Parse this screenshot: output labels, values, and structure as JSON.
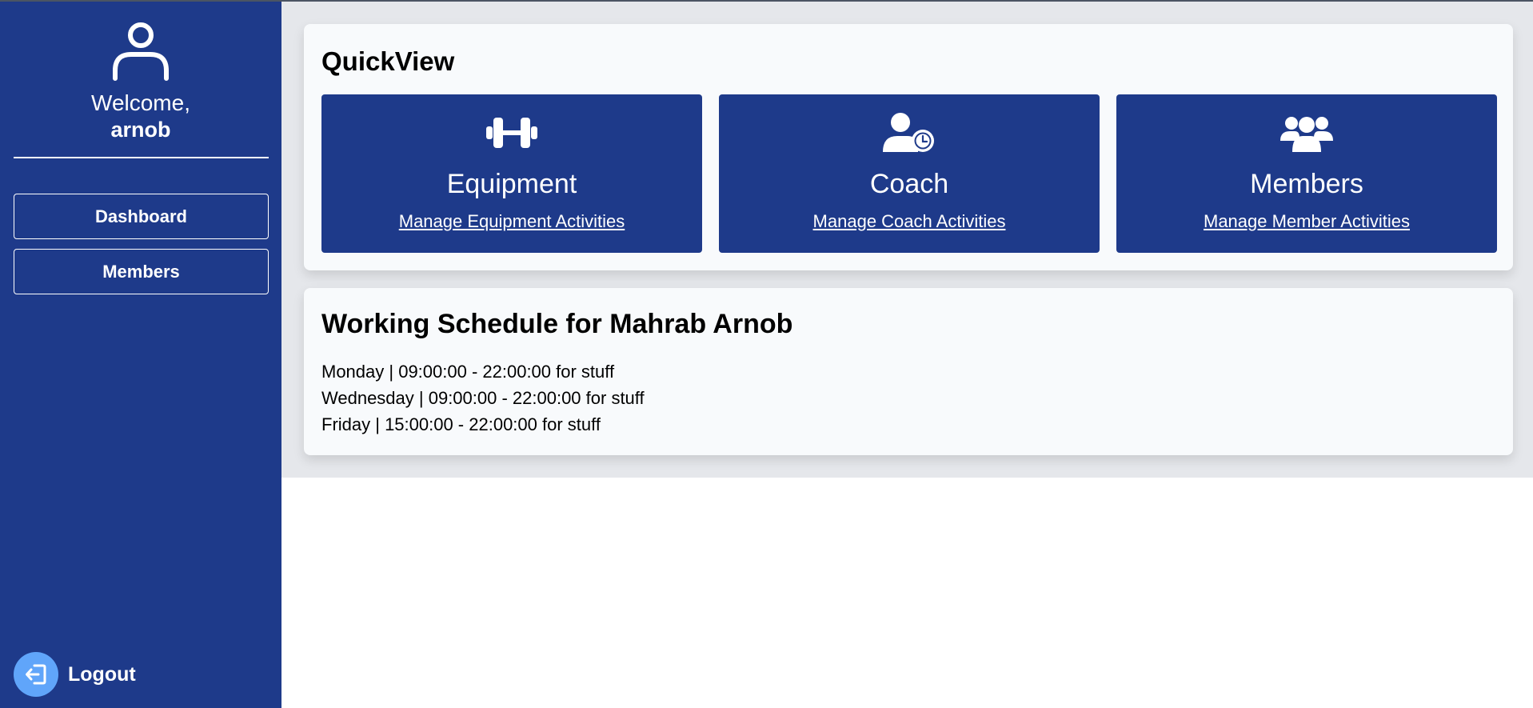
{
  "sidebar": {
    "welcome": "Welcome,",
    "username": "arnob",
    "nav": [
      {
        "label": "Dashboard"
      },
      {
        "label": "Members"
      }
    ],
    "logout_label": "Logout"
  },
  "quickview": {
    "title": "QuickView",
    "tiles": [
      {
        "icon": "dumbbell-icon",
        "title": "Equipment",
        "link": "Manage Equipment Activities"
      },
      {
        "icon": "user-clock-icon",
        "title": "Coach",
        "link": "Manage Coach Activities"
      },
      {
        "icon": "users-icon",
        "title": "Members",
        "link": "Manage Member Activities"
      }
    ]
  },
  "schedule": {
    "title": "Working Schedule for Mahrab Arnob",
    "items": [
      "Monday | 09:00:00 - 22:00:00 for stuff",
      "Wednesday | 09:00:00 - 22:00:00 for stuff",
      "Friday | 15:00:00 - 22:00:00 for stuff"
    ]
  },
  "colors": {
    "sidebar_bg": "#1e3a8a",
    "tile_bg": "#1e3a8a",
    "logout_circle": "#60a5fa",
    "main_bg": "#e5e7eb",
    "card_bg": "#f8fafc"
  }
}
